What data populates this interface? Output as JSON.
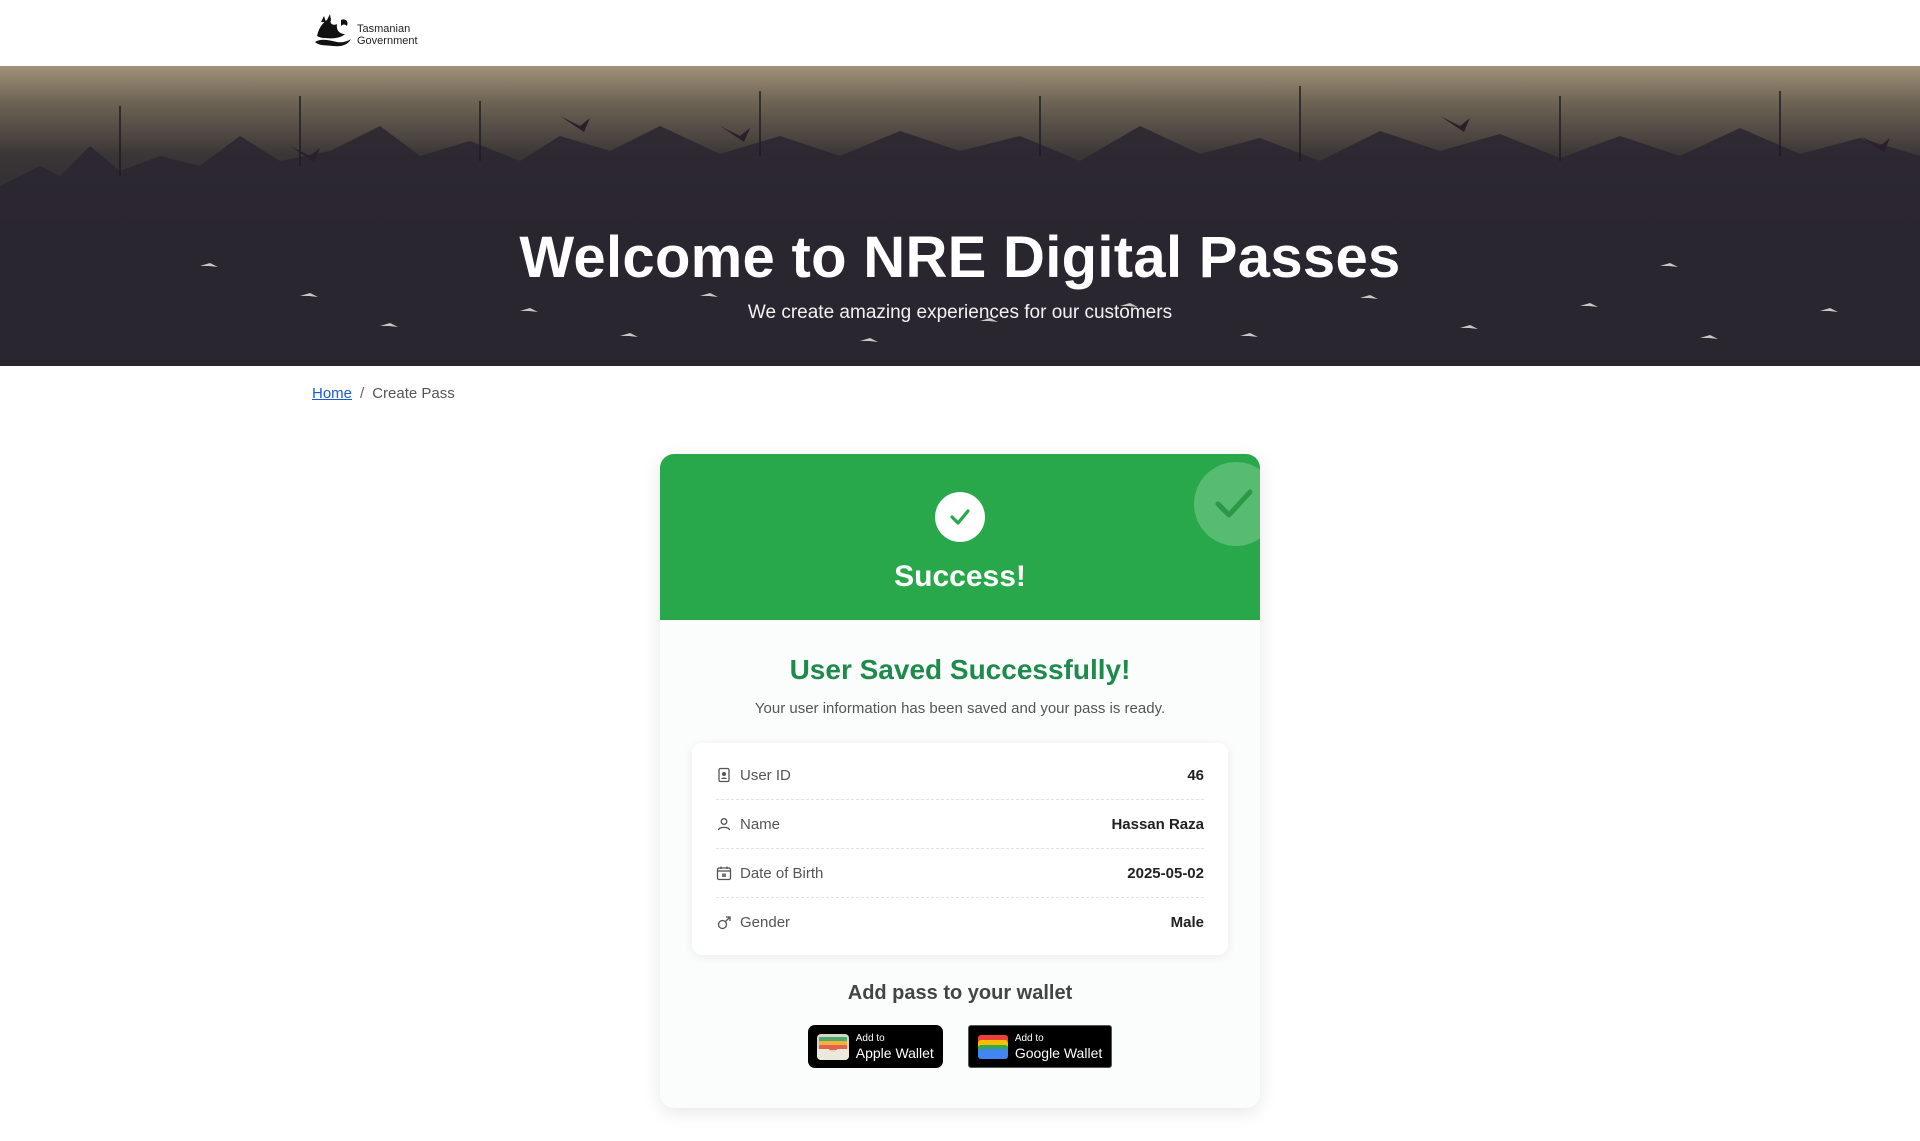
{
  "header": {
    "logo_line1": "Tasmanian",
    "logo_line2": "Government"
  },
  "hero": {
    "title": "Welcome to NRE Digital Passes",
    "subtitle": "We create amazing experiences for our customers"
  },
  "breadcrumb": {
    "home": "Home",
    "separator": "/",
    "current": "Create Pass"
  },
  "card": {
    "head_title": "Success!",
    "title": "User Saved Successfully!",
    "subtitle": "Your user information has been saved and your pass is ready.",
    "fields": [
      {
        "label": "User ID",
        "value": "46",
        "icon": "id-badge-icon"
      },
      {
        "label": "Name",
        "value": "Hassan Raza",
        "icon": "person-icon"
      },
      {
        "label": "Date of Birth",
        "value": "2025-05-02",
        "icon": "calendar-icon"
      },
      {
        "label": "Gender",
        "value": "Male",
        "icon": "male-icon"
      }
    ],
    "wallet_title": "Add pass to your wallet",
    "apple": {
      "small": "Add to",
      "big": "Apple Wallet"
    },
    "google": {
      "small": "Add to",
      "big": "Google Wallet"
    }
  },
  "colors": {
    "success_green": "#28a84a",
    "title_green": "#1e8a4c",
    "link_blue": "#1a5ccf"
  }
}
